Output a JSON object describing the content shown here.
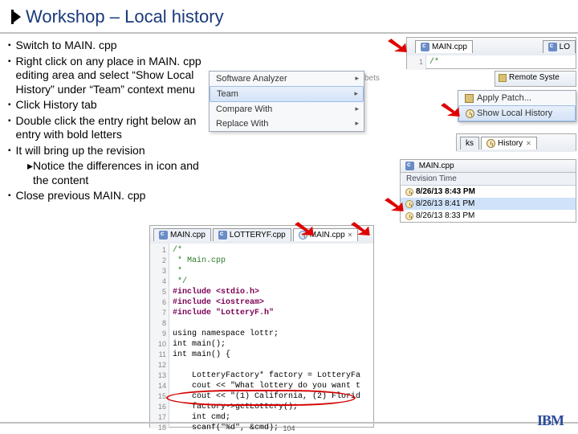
{
  "title": "Workshop – Local history",
  "instructions": {
    "items": [
      "Switch to MAIN. cpp",
      "Right click on any place in MAIN. cpp editing area and select “Show Local History” under “Team” context menu",
      "Click History tab",
      "Double click the entry right below an entry with bold letters",
      "It will bring up the revision"
    ],
    "sub_items": [
      "Notice the differences in icon and the content"
    ],
    "last_item": "Close previous MAIN. cpp"
  },
  "top_tabs": {
    "main": "MAIN.cpp",
    "other": "LO"
  },
  "top_line": "/*",
  "remote_label": "Remote Syste",
  "context_menu": {
    "analyzer": "Software Analyzer",
    "team": "Team",
    "compare": "Compare With",
    "replace": "Replace With",
    "bets_partial": "bets"
  },
  "sub_menu": {
    "apply": "Apply Patch...",
    "show_history": "Show Local History"
  },
  "history_tabs": {
    "ks": "ks",
    "history": "History"
  },
  "history_panel": {
    "file": "MAIN.cpp",
    "col": "Revision Time",
    "rows": [
      "8/26/13 8:43 PM",
      "8/26/13 8:41 PM",
      "8/26/13 8:33 PM"
    ]
  },
  "editor_tabs": {
    "main1": "MAIN.cpp",
    "lottery": "LOTTERYF.cpp",
    "main2": "MAIN.cpp"
  },
  "code": {
    "lines": [
      "/*",
      " * Main.cpp",
      " *",
      " */",
      "#include <stdio.h>",
      "#include <iostream>",
      "#include \"LotteryF.h\"",
      "",
      "using namespace lottr;",
      "int main();",
      "int main() {",
      "",
      "    LotteryFactory* factory = LotteryFa",
      "    cout << \"What lottery do you want t",
      "    cout << \"(1) California, (2) Florid",
      "    factory->getLottery();",
      "    int cmd;",
      "    scanf(\"%d\", &cmd);"
    ]
  },
  "page_num": "104",
  "ibm": "IBM"
}
